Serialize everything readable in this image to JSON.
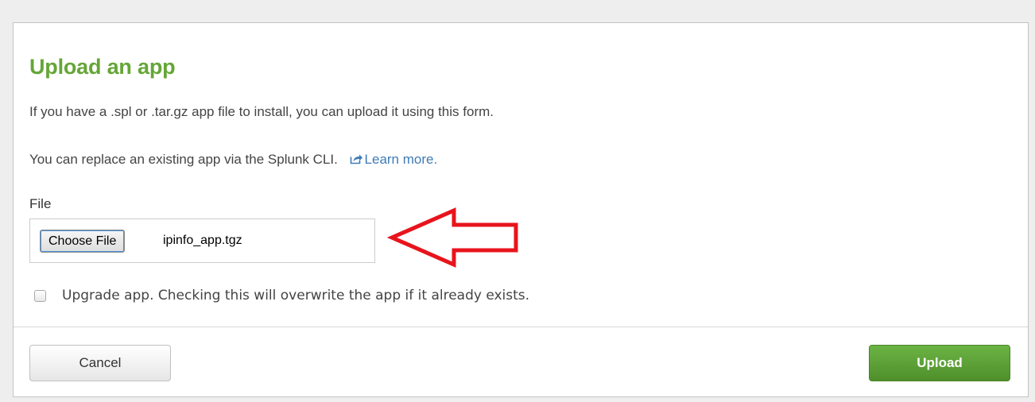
{
  "dialog": {
    "title": "Upload an app",
    "description": "If you have a .spl or .tar.gz app file to install, you can upload it using this form.",
    "replace_text": "You can replace an existing app via the Splunk CLI.",
    "learn_more_label": "Learn more.",
    "file_label": "File",
    "choose_file_label": "Choose File",
    "selected_file": "ipinfo_app.tgz",
    "upgrade_checkbox_label": "Upgrade app. Checking this will overwrite the app if it already exists.",
    "upgrade_checked": false,
    "cancel_label": "Cancel",
    "upload_label": "Upload"
  },
  "icons": {
    "external_link": "external-link-icon",
    "annotation_arrow": "left-arrow-annotation"
  },
  "colors": {
    "title": "#65a637",
    "link": "#3f7bb7",
    "upload_button": "#5ba135",
    "annotation_arrow": "#e8141c"
  }
}
